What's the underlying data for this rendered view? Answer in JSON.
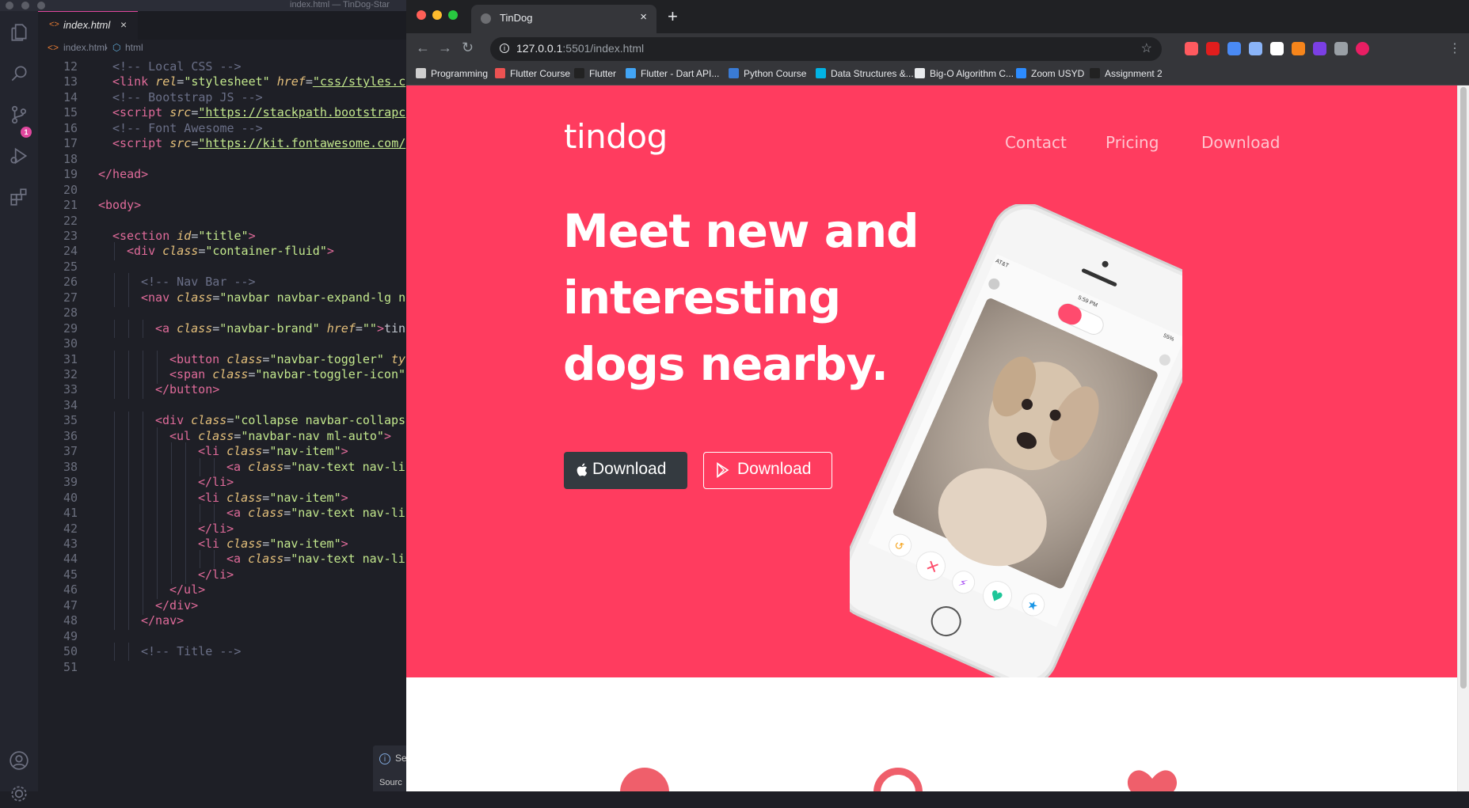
{
  "vscode": {
    "window_title": "index.html — TinDog-Star",
    "tab": {
      "label": "index.html",
      "close": "×"
    },
    "breadcrumb": {
      "file": "index.html",
      "node": "html"
    },
    "scm_badge": "1",
    "notification": {
      "icon": "i",
      "title": "Se",
      "source": "Sourc"
    },
    "code_lines": [
      {
        "n": "12",
        "indent": 1,
        "tokens": [
          [
            "com",
            "<!-- Local CSS -->"
          ]
        ]
      },
      {
        "n": "13",
        "indent": 1,
        "tokens": [
          [
            "tag",
            "<link "
          ],
          [
            "attr",
            "rel"
          ],
          [
            "pun",
            "="
          ],
          [
            "str",
            "\"stylesheet\""
          ],
          [
            "pun",
            " "
          ],
          [
            "attr",
            "href"
          ],
          [
            "pun",
            "="
          ],
          [
            "strl",
            "\"css/styles.c"
          ]
        ]
      },
      {
        "n": "14",
        "indent": 1,
        "tokens": [
          [
            "com",
            "<!-- Bootstrap JS -->"
          ]
        ]
      },
      {
        "n": "15",
        "indent": 1,
        "tokens": [
          [
            "tag",
            "<script "
          ],
          [
            "attr",
            "src"
          ],
          [
            "pun",
            "="
          ],
          [
            "strl",
            "\"https://stackpath.bootstrapc"
          ]
        ]
      },
      {
        "n": "16",
        "indent": 1,
        "tokens": [
          [
            "com",
            "<!-- Font Awesome -->"
          ]
        ]
      },
      {
        "n": "17",
        "indent": 1,
        "tokens": [
          [
            "tag",
            "<script "
          ],
          [
            "attr",
            "src"
          ],
          [
            "pun",
            "="
          ],
          [
            "strl",
            "\"https://kit.fontawesome.com/"
          ]
        ]
      },
      {
        "n": "18",
        "indent": 0,
        "tokens": []
      },
      {
        "n": "19",
        "indent": 0,
        "tokens": [
          [
            "tag",
            "</head>"
          ]
        ]
      },
      {
        "n": "20",
        "indent": 0,
        "tokens": []
      },
      {
        "n": "21",
        "indent": 0,
        "tokens": [
          [
            "tag",
            "<body>"
          ]
        ]
      },
      {
        "n": "22",
        "indent": 0,
        "tokens": []
      },
      {
        "n": "23",
        "indent": 1,
        "tokens": [
          [
            "tag",
            "<section "
          ],
          [
            "attr",
            "id"
          ],
          [
            "pun",
            "="
          ],
          [
            "str",
            "\"title\""
          ],
          [
            "tag",
            ">"
          ]
        ]
      },
      {
        "n": "24",
        "indent": 2,
        "tokens": [
          [
            "tag",
            "<div "
          ],
          [
            "attr",
            "class"
          ],
          [
            "pun",
            "="
          ],
          [
            "str",
            "\"container-fluid\""
          ],
          [
            "tag",
            ">"
          ]
        ]
      },
      {
        "n": "25",
        "indent": 0,
        "tokens": []
      },
      {
        "n": "26",
        "indent": 3,
        "tokens": [
          [
            "com",
            "<!-- Nav Bar -->"
          ]
        ]
      },
      {
        "n": "27",
        "indent": 3,
        "tokens": [
          [
            "tag",
            "<nav "
          ],
          [
            "attr",
            "class"
          ],
          [
            "pun",
            "="
          ],
          [
            "str",
            "\"navbar navbar-expand-lg n"
          ]
        ]
      },
      {
        "n": "28",
        "indent": 0,
        "tokens": []
      },
      {
        "n": "29",
        "indent": 4,
        "tokens": [
          [
            "tag",
            "<a "
          ],
          [
            "attr",
            "class"
          ],
          [
            "pun",
            "="
          ],
          [
            "str",
            "\"navbar-brand\""
          ],
          [
            "pun",
            " "
          ],
          [
            "attr",
            "href"
          ],
          [
            "pun",
            "="
          ],
          [
            "str",
            "\"\""
          ],
          [
            "tag",
            ">"
          ],
          [
            "pun",
            "tin"
          ]
        ]
      },
      {
        "n": "30",
        "indent": 0,
        "tokens": []
      },
      {
        "n": "31",
        "indent": 5,
        "tokens": [
          [
            "tag",
            "<button "
          ],
          [
            "attr",
            "class"
          ],
          [
            "pun",
            "="
          ],
          [
            "str",
            "\"navbar-toggler\""
          ],
          [
            "pun",
            " "
          ],
          [
            "attr",
            "ty"
          ]
        ]
      },
      {
        "n": "32",
        "indent": 5,
        "tokens": [
          [
            "tag",
            "<span "
          ],
          [
            "attr",
            "class"
          ],
          [
            "pun",
            "="
          ],
          [
            "str",
            "\"navbar-toggler-icon\""
          ]
        ]
      },
      {
        "n": "33",
        "indent": 4,
        "tokens": [
          [
            "tag",
            "</button>"
          ]
        ]
      },
      {
        "n": "34",
        "indent": 0,
        "tokens": []
      },
      {
        "n": "35",
        "indent": 4,
        "tokens": [
          [
            "tag",
            "<div "
          ],
          [
            "attr",
            "class"
          ],
          [
            "pun",
            "="
          ],
          [
            "str",
            "\"collapse navbar-collaps"
          ]
        ]
      },
      {
        "n": "36",
        "indent": 5,
        "tokens": [
          [
            "tag",
            "<ul "
          ],
          [
            "attr",
            "class"
          ],
          [
            "pun",
            "="
          ],
          [
            "str",
            "\"navbar-nav ml-auto\""
          ],
          [
            "tag",
            ">"
          ]
        ]
      },
      {
        "n": "37",
        "indent": 7,
        "tokens": [
          [
            "tag",
            "<li "
          ],
          [
            "attr",
            "class"
          ],
          [
            "pun",
            "="
          ],
          [
            "str",
            "\"nav-item\""
          ],
          [
            "tag",
            ">"
          ]
        ]
      },
      {
        "n": "38",
        "indent": 9,
        "tokens": [
          [
            "tag",
            "<a "
          ],
          [
            "attr",
            "class"
          ],
          [
            "pun",
            "="
          ],
          [
            "str",
            "\"nav-text nav-li"
          ]
        ]
      },
      {
        "n": "39",
        "indent": 7,
        "tokens": [
          [
            "tag",
            "</li>"
          ]
        ]
      },
      {
        "n": "40",
        "indent": 7,
        "tokens": [
          [
            "tag",
            "<li "
          ],
          [
            "attr",
            "class"
          ],
          [
            "pun",
            "="
          ],
          [
            "str",
            "\"nav-item\""
          ],
          [
            "tag",
            ">"
          ]
        ]
      },
      {
        "n": "41",
        "indent": 9,
        "tokens": [
          [
            "tag",
            "<a "
          ],
          [
            "attr",
            "class"
          ],
          [
            "pun",
            "="
          ],
          [
            "str",
            "\"nav-text nav-li"
          ]
        ]
      },
      {
        "n": "42",
        "indent": 7,
        "tokens": [
          [
            "tag",
            "</li>"
          ]
        ]
      },
      {
        "n": "43",
        "indent": 7,
        "tokens": [
          [
            "tag",
            "<li "
          ],
          [
            "attr",
            "class"
          ],
          [
            "pun",
            "="
          ],
          [
            "str",
            "\"nav-item\""
          ],
          [
            "tag",
            ">"
          ]
        ]
      },
      {
        "n": "44",
        "indent": 9,
        "tokens": [
          [
            "tag",
            "<a "
          ],
          [
            "attr",
            "class"
          ],
          [
            "pun",
            "="
          ],
          [
            "str",
            "\"nav-text nav-li"
          ]
        ]
      },
      {
        "n": "45",
        "indent": 7,
        "tokens": [
          [
            "tag",
            "</li>"
          ]
        ]
      },
      {
        "n": "46",
        "indent": 5,
        "tokens": [
          [
            "tag",
            "</ul>"
          ]
        ]
      },
      {
        "n": "47",
        "indent": 4,
        "tokens": [
          [
            "tag",
            "</div>"
          ]
        ]
      },
      {
        "n": "48",
        "indent": 3,
        "tokens": [
          [
            "tag",
            "</nav>"
          ]
        ]
      },
      {
        "n": "49",
        "indent": 0,
        "tokens": []
      },
      {
        "n": "50",
        "indent": 3,
        "tokens": [
          [
            "com",
            "<!-- Title -->"
          ]
        ]
      },
      {
        "n": "51",
        "indent": 0,
        "tokens": []
      }
    ]
  },
  "browser": {
    "tab_title": "TinDog",
    "tab_close": "×",
    "new_tab": "+",
    "url_host": "127.0.0.1",
    "url_rest": ":5501/index.html",
    "bookmarks": [
      {
        "label": "Programming",
        "icon": "folder-icon",
        "color": "#cfcfcf"
      },
      {
        "label": "Flutter Course",
        "icon": "udemy-icon",
        "color": "#ec5252"
      },
      {
        "label": "Flutter",
        "icon": "github-icon",
        "color": "#222222"
      },
      {
        "label": "Flutter - Dart API...",
        "icon": "flutter-icon",
        "color": "#42a5f5"
      },
      {
        "label": "Python Course",
        "icon": "python-course-icon",
        "color": "#3a7bd5"
      },
      {
        "label": "Data Structures &...",
        "icon": "udacity-icon",
        "color": "#02b3e4"
      },
      {
        "label": "Big-O Algorithm C...",
        "icon": "globe-icon",
        "color": "#e8eaed"
      },
      {
        "label": "Zoom USYD",
        "icon": "zoom-icon",
        "color": "#2d8cff"
      },
      {
        "label": "Assignment 2",
        "icon": "github-icon",
        "color": "#222222"
      }
    ],
    "extensions": [
      {
        "icon": "brave-shield-icon",
        "color": "#ff5a5f"
      },
      {
        "icon": "adblock-icon",
        "color": "#e11d1d"
      },
      {
        "icon": "google-translate-icon",
        "color": "#4a8af4"
      },
      {
        "icon": "pen-icon",
        "color": "#8ab4f8"
      },
      {
        "icon": "notion-icon",
        "color": "#ffffff"
      },
      {
        "icon": "metamask-icon",
        "color": "#f6851b"
      },
      {
        "icon": "r-extension-icon",
        "color": "#7b3fe4"
      },
      {
        "icon": "puzzle-icon",
        "color": "#9aa0a6"
      },
      {
        "icon": "profile-avatar-icon",
        "color": "#e91e63"
      }
    ]
  },
  "site": {
    "brand": "tindog",
    "nav": [
      "Contact",
      "Pricing",
      "Download"
    ],
    "headline": [
      "Meet new and",
      "interesting",
      "dogs nearby."
    ],
    "buttons": {
      "apple_download": "Download",
      "play_download": "Download"
    },
    "colors": {
      "hero": "#ff3c5f",
      "dark_button": "#343a40",
      "feature_icons": "#ef5f6b"
    },
    "phone": {
      "carrier": "AT&T",
      "time": "5:59 PM",
      "battery": "55%"
    }
  }
}
